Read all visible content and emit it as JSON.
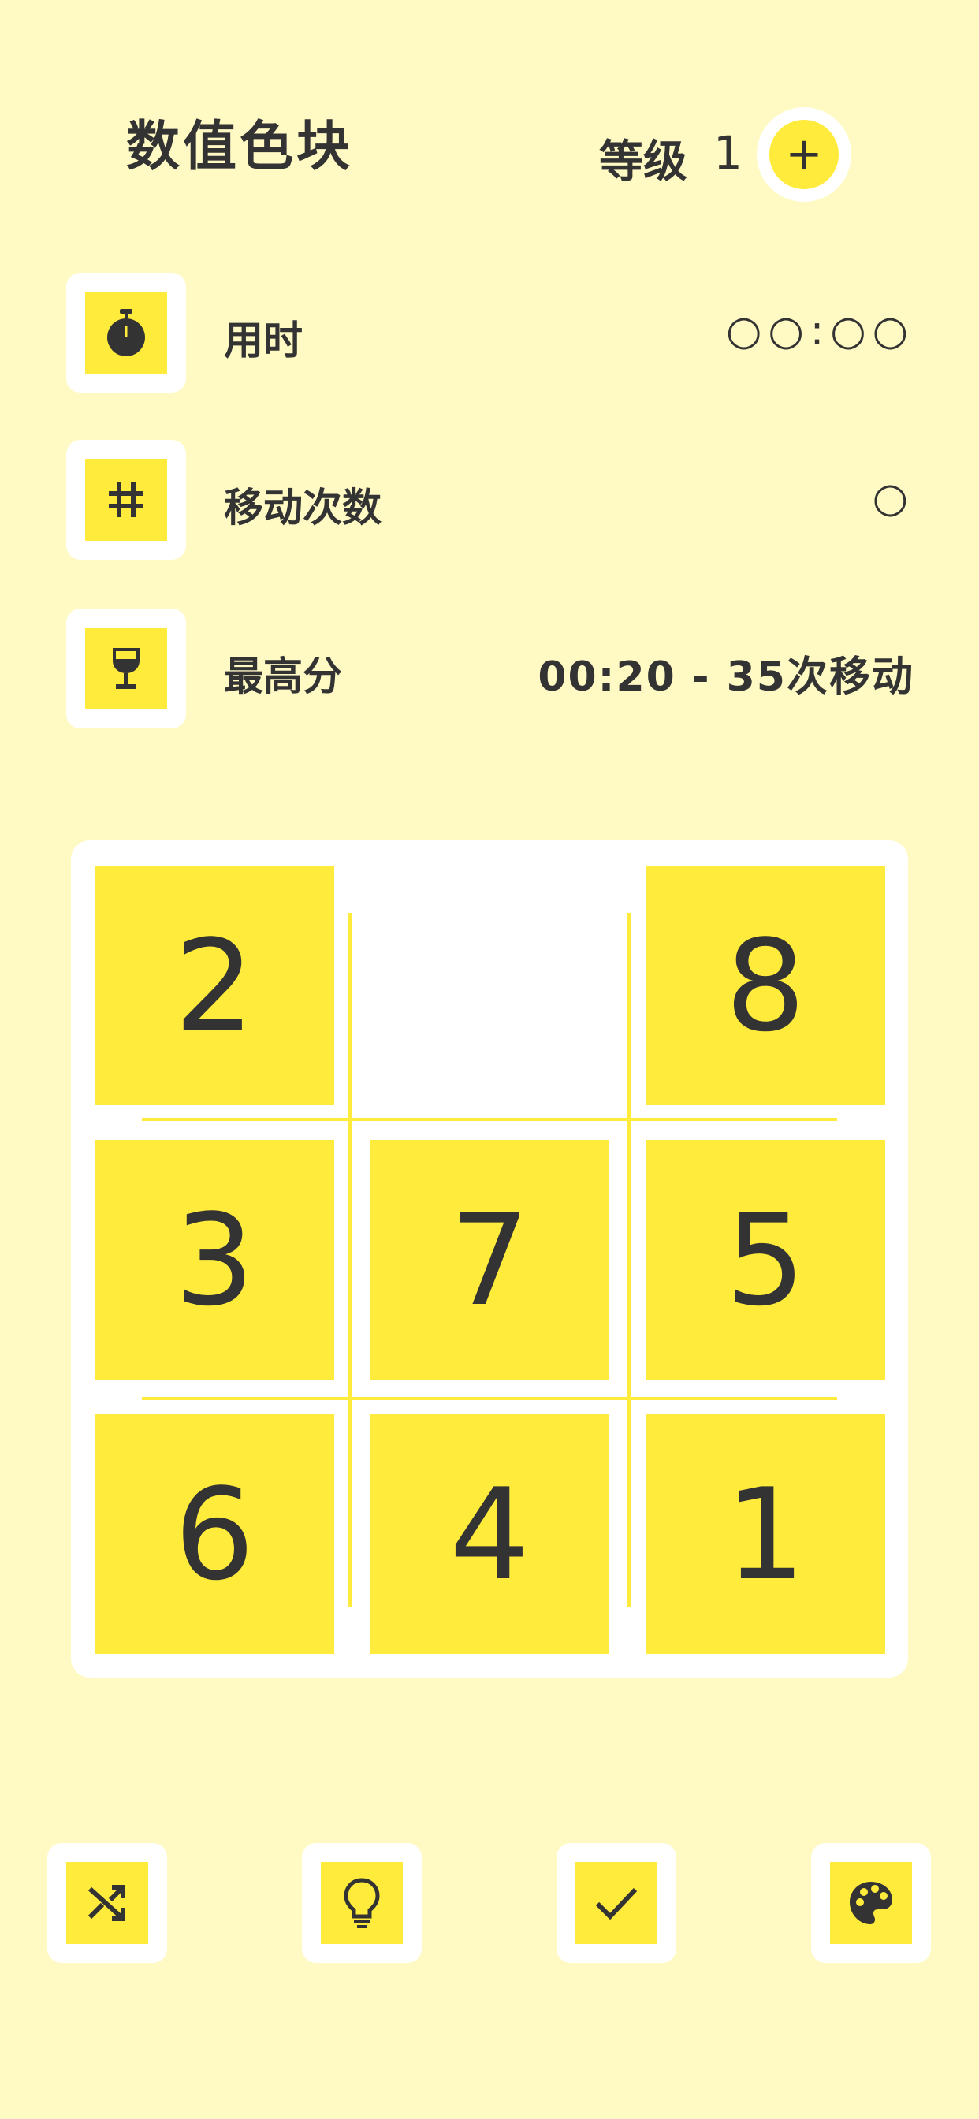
{
  "header": {
    "title": "数值色块",
    "level_label": "等级",
    "level_value": "1",
    "level_up_symbol": "+"
  },
  "stats": [
    {
      "icon": "stopwatch-icon",
      "label": "用时",
      "value": "○○:○○"
    },
    {
      "icon": "hash-icon",
      "label": "移动次数",
      "value": "○"
    },
    {
      "icon": "trophy-cup-icon",
      "label": "最高分",
      "value": "00:20 - 35次移动"
    }
  ],
  "board": {
    "rows": [
      [
        "2",
        "",
        "8"
      ],
      [
        "3",
        "7",
        "5"
      ],
      [
        "6",
        "4",
        "1"
      ]
    ]
  },
  "toolbar": [
    {
      "icon": "shuffle-icon"
    },
    {
      "icon": "lightbulb-icon"
    },
    {
      "icon": "checkmark-icon"
    },
    {
      "icon": "palette-icon"
    }
  ],
  "colors": {
    "background": "#fff9c4",
    "accent": "#ffeb3b",
    "text": "#333333",
    "panel": "#ffffff"
  }
}
